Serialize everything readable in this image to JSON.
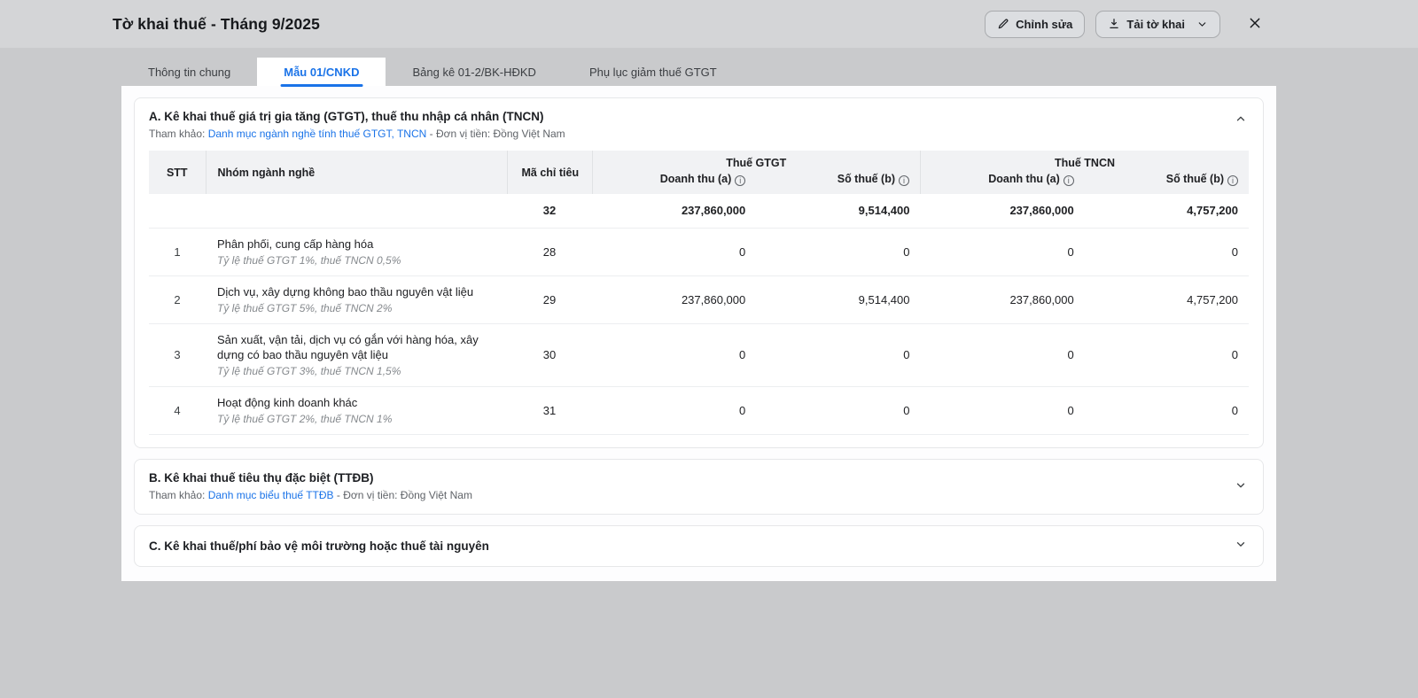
{
  "colors": {
    "accent": "#1a73e8",
    "link": "#1a73e8"
  },
  "icons": {
    "edit": "pencil-icon",
    "download": "download-icon",
    "download_more": "chevron-down-icon",
    "close": "close-icon",
    "info": "info-icon",
    "section_expanded": "chevron-up-icon",
    "section_collapsed": "chevron-down-icon"
  },
  "topbar": {
    "title": "Tờ khai thuế - Tháng 9/2025",
    "edit_label": "Chỉnh sửa",
    "download_label": "Tải tờ khai"
  },
  "tabs": {
    "active_index": 1,
    "items": [
      {
        "label": "Thông tin chung"
      },
      {
        "label": "Mẫu 01/CNKD"
      },
      {
        "label": "Bảng kê 01-2/BK-HĐKD"
      },
      {
        "label": "Phụ lục giảm thuế GTGT"
      }
    ]
  },
  "section_a": {
    "title": "A. Kê khai thuế giá trị gia tăng (GTGT), thuế thu nhập cá nhân (TNCN)",
    "ref_prefix": "Tham khảo: ",
    "ref_link": "Danh mục ngành nghề tính thuế GTGT, TNCN",
    "ref_suffix": " - Đơn vị tiền: Đồng Việt Nam",
    "table": {
      "col_stt": "STT",
      "col_group": "Nhóm ngành nghề",
      "col_code": "Mã chỉ tiêu",
      "group_gtgt": "Thuế GTGT",
      "group_tncn": "Thuế TNCN",
      "col_revenue": "Doanh thu (a)",
      "col_tax": "Số thuế (b)",
      "total": {
        "code": "32",
        "gtgt_revenue": "237,860,000",
        "gtgt_tax": "9,514,400",
        "tncn_revenue": "237,860,000",
        "tncn_tax": "4,757,200"
      },
      "rows": [
        {
          "stt": "1",
          "name": "Phân phối, cung cấp hàng hóa",
          "note": "Tỷ lệ thuế GTGT 1%, thuế TNCN 0,5%",
          "code": "28",
          "gtgt_revenue": "0",
          "gtgt_tax": "0",
          "tncn_revenue": "0",
          "tncn_tax": "0"
        },
        {
          "stt": "2",
          "name": "Dịch vụ, xây dựng không bao thầu nguyên vật liệu",
          "note": "Tỷ lệ thuế GTGT 5%, thuế TNCN 2%",
          "code": "29",
          "gtgt_revenue": "237,860,000",
          "gtgt_tax": "9,514,400",
          "tncn_revenue": "237,860,000",
          "tncn_tax": "4,757,200"
        },
        {
          "stt": "3",
          "name": "Sản xuất, vận tải, dịch vụ có gắn với hàng hóa, xây dựng có bao thầu nguyên vật liệu",
          "note": "Tỷ lệ thuế GTGT 3%, thuế TNCN 1,5%",
          "code": "30",
          "gtgt_revenue": "0",
          "gtgt_tax": "0",
          "tncn_revenue": "0",
          "tncn_tax": "0"
        },
        {
          "stt": "4",
          "name": "Hoạt động kinh doanh khác",
          "note": "Tỷ lệ thuế GTGT 2%, thuế TNCN 1%",
          "code": "31",
          "gtgt_revenue": "0",
          "gtgt_tax": "0",
          "tncn_revenue": "0",
          "tncn_tax": "0"
        }
      ]
    }
  },
  "section_b": {
    "title": "B. Kê khai thuế tiêu thụ đặc biệt (TTĐB)",
    "ref_prefix": "Tham khảo: ",
    "ref_link": "Danh mục biểu thuế TTĐB",
    "ref_suffix": " - Đơn vị tiền: Đồng Việt Nam"
  },
  "section_c": {
    "title": "C. Kê khai thuế/phí bảo vệ môi trường hoặc thuế tài nguyên"
  }
}
